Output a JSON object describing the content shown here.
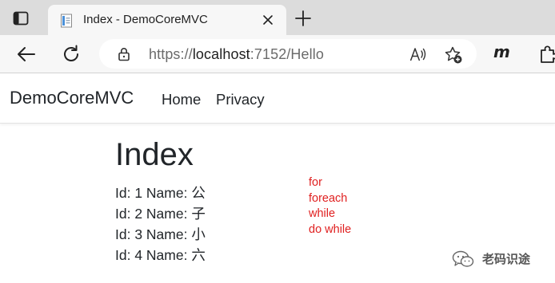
{
  "browser": {
    "tab": {
      "title": "Index - DemoCoreMVC"
    },
    "address": {
      "scheme": "https://",
      "host": "localhost",
      "rest": ":7152/Hello"
    },
    "profile_label": "m"
  },
  "site": {
    "brand": "DemoCoreMVC",
    "nav": [
      {
        "label": "Home"
      },
      {
        "label": "Privacy"
      }
    ]
  },
  "main": {
    "title": "Index",
    "people": [
      {
        "text": "Id: 1 Name: 公"
      },
      {
        "text": "Id: 2 Name: 子"
      },
      {
        "text": "Id: 3 Name: 小"
      },
      {
        "text": "Id: 4 Name: 六"
      }
    ]
  },
  "annotation": {
    "color": "#e02020",
    "lines": [
      "for",
      "foreach",
      "while",
      "do while"
    ]
  },
  "watermark": {
    "text": "老码识途"
  },
  "icons": {
    "tab_actions": "tab-actions-icon",
    "favicon": "document-favicon-icon",
    "close": "close-icon",
    "new_tab": "plus-icon",
    "back": "arrow-left-icon",
    "reload": "reload-icon",
    "lock": "lock-icon",
    "read_aloud": "read-aloud-icon",
    "favorite": "star-plus-icon",
    "extensions": "puzzle-icon"
  }
}
